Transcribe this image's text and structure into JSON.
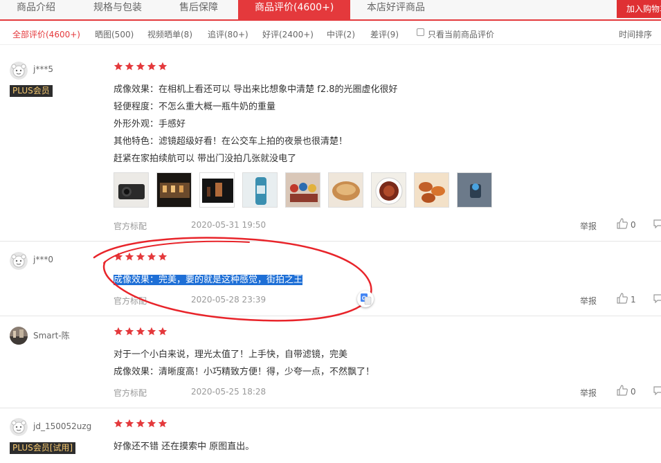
{
  "tabs": [
    "商品介绍",
    "规格与包装",
    "售后保障",
    "商品评价(4600+)",
    "本店好评商品"
  ],
  "cart_button": "加入购物车",
  "filters": [
    "全部评价(4600+)",
    "晒图(500)",
    "视频晒单(8)",
    "追评(80+)",
    "好评(2400+)",
    "中评(2)",
    "差评(9)"
  ],
  "only_current_label": "只看当前商品评价",
  "sort_label": "时间排序",
  "colors": {
    "accent": "#e4393c",
    "highlight": "#1e6fd6",
    "annotation": "#e8242a"
  },
  "reviews": [
    {
      "user": "j***5",
      "badge": "PLUS会员",
      "rating": 5,
      "lines": [
        "成像效果：在相机上看还可以 导出来比想象中清楚 f2.8的光圈虚化很好",
        "轻便程度：不怎么重大概一瓶牛奶的重量",
        "外形外观：手感好",
        "其他特色：滤镜超级好看！在公交车上拍的夜景也很清楚！",
        "赶紧在家拍续航可以 带出门没拍几张就没电了"
      ],
      "image_count": 9,
      "spec": "官方标配",
      "date": "2020-05-31 19:50",
      "report": "举报",
      "likes": "0"
    },
    {
      "user": "j***0",
      "rating": 5,
      "lines": [
        "成像效果：完美，要的就是这种感觉，街拍之王"
      ],
      "spec": "官方标配",
      "date": "2020-05-28 23:39",
      "report": "举报",
      "likes": "1"
    },
    {
      "user": "Smart-陈",
      "rating": 5,
      "lines": [
        "对于一个小白来说，理光太值了！上手快，自带滤镜，完美",
        "成像效果：清晰度高！小巧精致方便！得，少夸一点，不然飘了！"
      ],
      "spec": "官方标配",
      "date": "2020-05-25 18:28",
      "report": "举报",
      "likes": "0"
    },
    {
      "user": "jd_150052uzg",
      "badge": "PLUS会员[试用]",
      "rating": 5,
      "lines": [
        "好像还不错 还在摸索中 原图直出。"
      ]
    }
  ]
}
